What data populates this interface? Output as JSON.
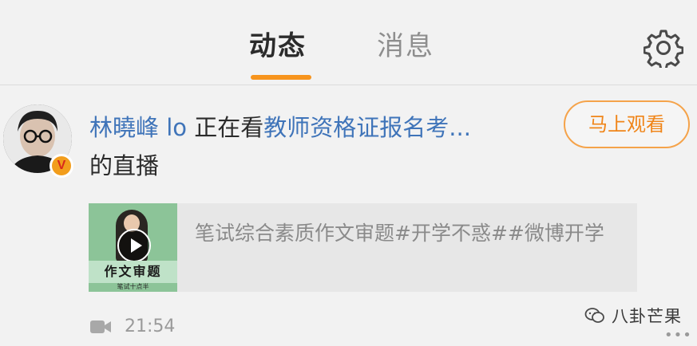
{
  "header": {
    "tabs": [
      {
        "label": "动态",
        "active": true
      },
      {
        "label": "消息",
        "active": false
      }
    ],
    "accent_color": "#f7941d",
    "settings_icon": "gear-icon"
  },
  "feed_item": {
    "user_name": "林曉峰 lo",
    "verified_badge": "V",
    "action_text": "正在看",
    "channel_title": "教师资格证报名考...",
    "suffix": "的直播",
    "watch_button": "马上观看",
    "preview": {
      "thumb_caption": "作文审题",
      "thumb_sub": "笔试十点半",
      "description": "笔试综合素质作文审题#开学不惑##微博开学"
    },
    "time": "21:54",
    "time_icon": "video-camera-icon"
  },
  "watermark": {
    "icon": "wechat-icon",
    "text": "八卦芒果"
  },
  "overflow": "•••"
}
